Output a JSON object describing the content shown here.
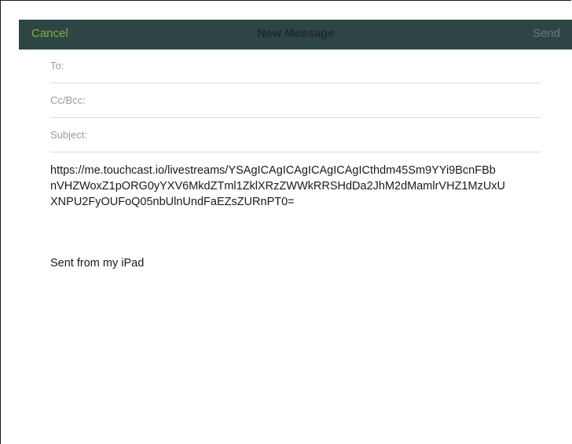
{
  "navbar": {
    "cancel_label": "Cancel",
    "title": "New Message",
    "send_label": "Send"
  },
  "fields": {
    "to_label": "To:",
    "cc_bcc_label": "Cc/Bcc:",
    "subject_label": "Subject:"
  },
  "body": {
    "link_line_1": "https://me.touchcast.io/livestreams/YSAgICAgICAgICAgICAgICthdm45Sm9YYi9BcnFBb",
    "link_line_2": "nVHZWoxZ1pORG0yYXV6MkdZTml1ZklXRzZWWkRRSHdDa2JhM2dMamlrVHZ1MzUxU",
    "link_line_3": "XNPU2FyOUFoQ05nbUlnUndFaEZsZURnPT0=",
    "signature": "Sent from my iPad"
  },
  "colors": {
    "navbar_bg": "#2e4545",
    "cancel_color": "#7cb342",
    "send_color": "#6a7a7a"
  }
}
